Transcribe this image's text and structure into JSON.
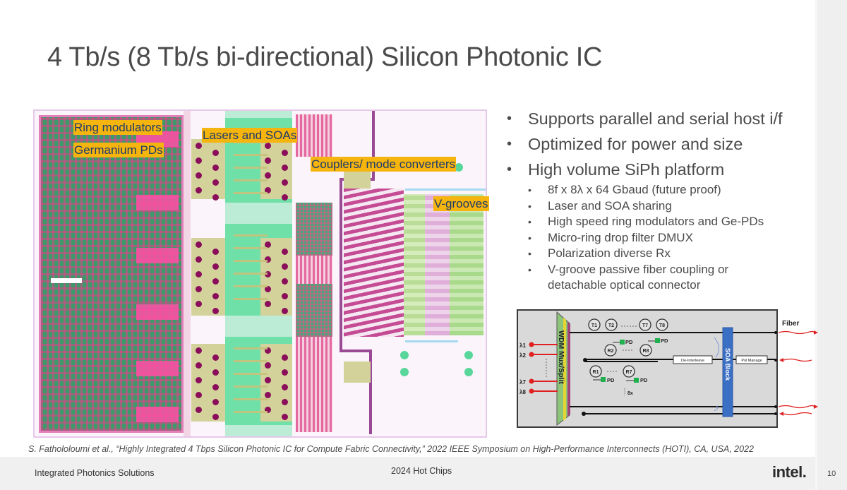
{
  "slide": {
    "title": "4 Tb/s (8 Tb/s bi-directional) Silicon Photonic IC",
    "page_number": "10"
  },
  "chip_image": {
    "labels": [
      {
        "id": "ring-modulators",
        "text": "Ring modulators"
      },
      {
        "id": "germanium-pds",
        "text": "Germanium PDs"
      },
      {
        "id": "lasers-soas",
        "text": "Lasers and SOAs"
      },
      {
        "id": "couplers",
        "text": "Couplers/ mode converters"
      },
      {
        "id": "v-grooves",
        "text": "V-grooves"
      }
    ]
  },
  "bullets": {
    "main": [
      "Supports parallel and serial host i/f",
      "Optimized for power and size",
      "High volume SiPh platform"
    ],
    "sub": [
      "8f x 8λ x 64 Gbaud (future proof)",
      "Laser and SOA sharing",
      "High speed ring modulators and Ge-PDs",
      "Micro-ring drop filter DMUX",
      "Polarization diverse Rx",
      "V-groove passive fiber coupling or",
      "detachable optical connector"
    ]
  },
  "diagram": {
    "wavelengths": [
      "λ1",
      "λ2",
      "λ7",
      "λ8"
    ],
    "mux_label": "WDM Mux/Split",
    "tx_rings": [
      "T1",
      "T2",
      "T7",
      "T8"
    ],
    "rx_rings_top": [
      "R2",
      "R8"
    ],
    "rx_rings_bottom": [
      "R1",
      "R7"
    ],
    "pd_label": "PD",
    "repeat_label": "8x",
    "deinterleave_label": "De-Interleave",
    "pol_manage_label": "Pol Manage",
    "soa_label": "SOA Block",
    "fiber_label": "Fiber",
    "colors": {
      "laser_red": "#e02020",
      "pd_green": "#21b14c",
      "soa_blue": "#3a6fc4"
    }
  },
  "citation": "S. Fathololoumi et al., “Highly Integrated 4 Tbps Silicon Photonic IC for Compute Fabric Connectivity,” 2022 IEEE Symposium on High-Performance Interconnects (HOTI), CA, USA, 2022",
  "footer": {
    "left": "Integrated Photonics Solutions",
    "center": "2024 Hot Chips",
    "logo": "intel."
  }
}
